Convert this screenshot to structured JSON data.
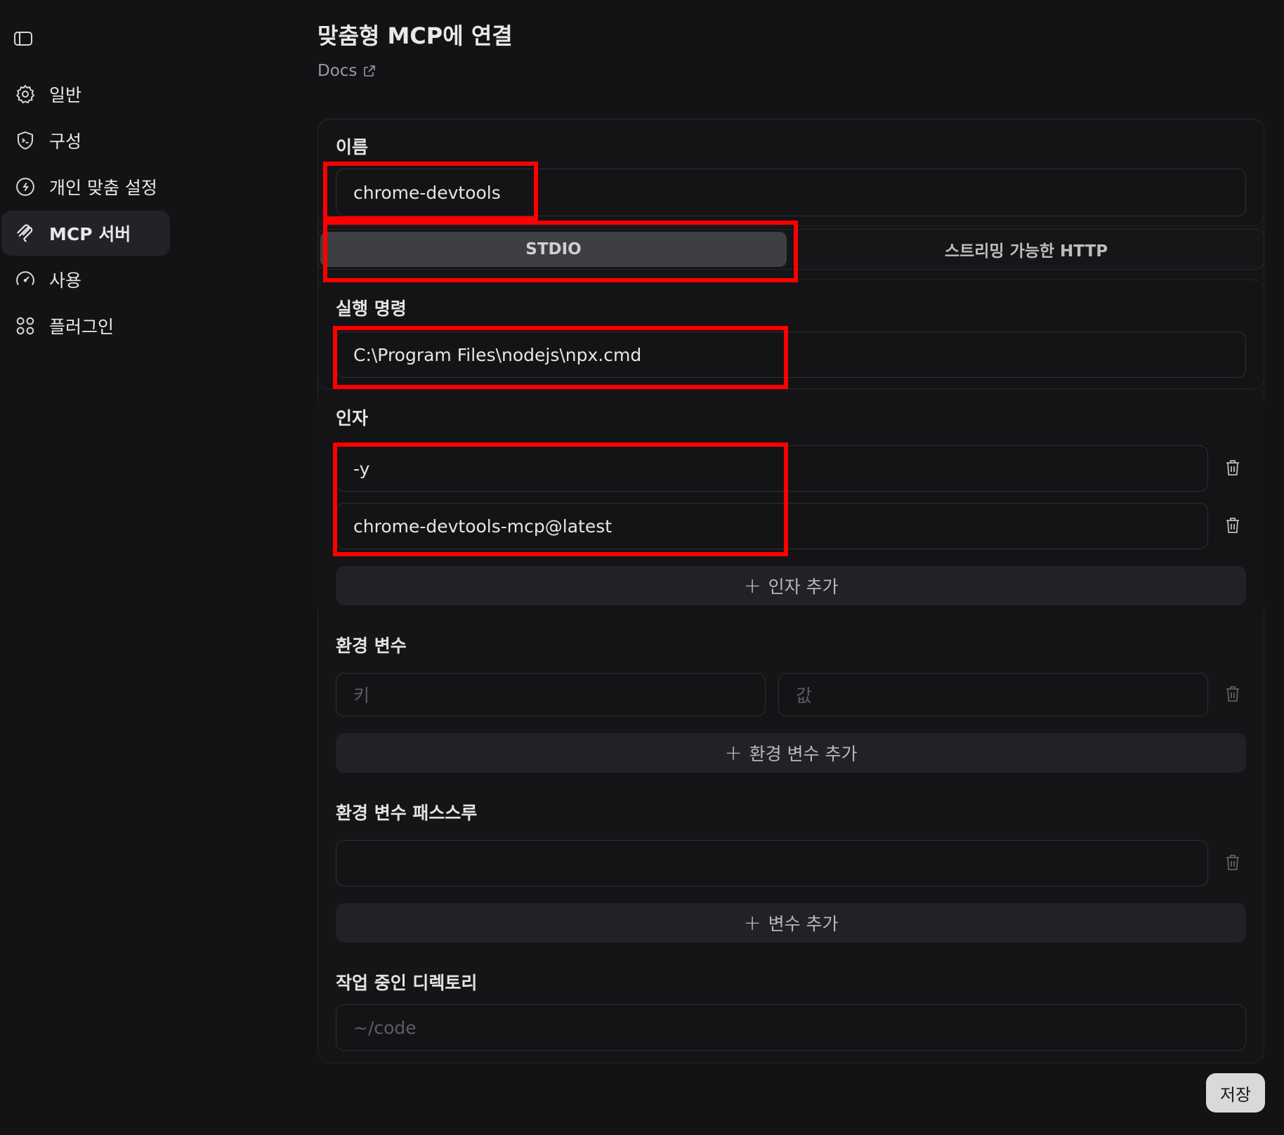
{
  "sidebar": {
    "items": [
      {
        "label": "일반",
        "icon": "gear-icon"
      },
      {
        "label": "구성",
        "icon": "shield-terminal-icon"
      },
      {
        "label": "개인 맞춤 설정",
        "icon": "personalize-icon"
      },
      {
        "label": "MCP 서버",
        "icon": "mcp-icon",
        "active": true
      },
      {
        "label": "사용",
        "icon": "gauge-icon"
      },
      {
        "label": "플러그인",
        "icon": "grid-dots-icon"
      }
    ]
  },
  "header": {
    "title": "맞춤형 MCP에 연결",
    "docs_label": "Docs"
  },
  "form": {
    "name_label": "이름",
    "name_value": "chrome-devtools",
    "tabs": [
      "STDIO",
      "스트리밍 가능한 HTTP"
    ],
    "active_tab": "STDIO",
    "command_label": "실행 명령",
    "command_value": "C:\\Program Files\\nodejs\\npx.cmd",
    "args_label": "인자",
    "args": [
      "-y",
      "chrome-devtools-mcp@latest"
    ],
    "add_arg_label": "인자 추가",
    "env_label": "환경 변수",
    "env_key_placeholder": "키",
    "env_value_placeholder": "값",
    "add_env_label": "환경 변수 추가",
    "passthrough_label": "환경 변수 패스스루",
    "passthrough_value": "",
    "add_var_label": "변수 추가",
    "cwd_label": "작업 중인 디렉토리",
    "cwd_placeholder": "~/code"
  },
  "save_label": "저장",
  "colors": {
    "background": "#131315",
    "highlight": "#ff0000",
    "active_tab": "#3e3f42",
    "save_button": "#d9d9d9"
  }
}
